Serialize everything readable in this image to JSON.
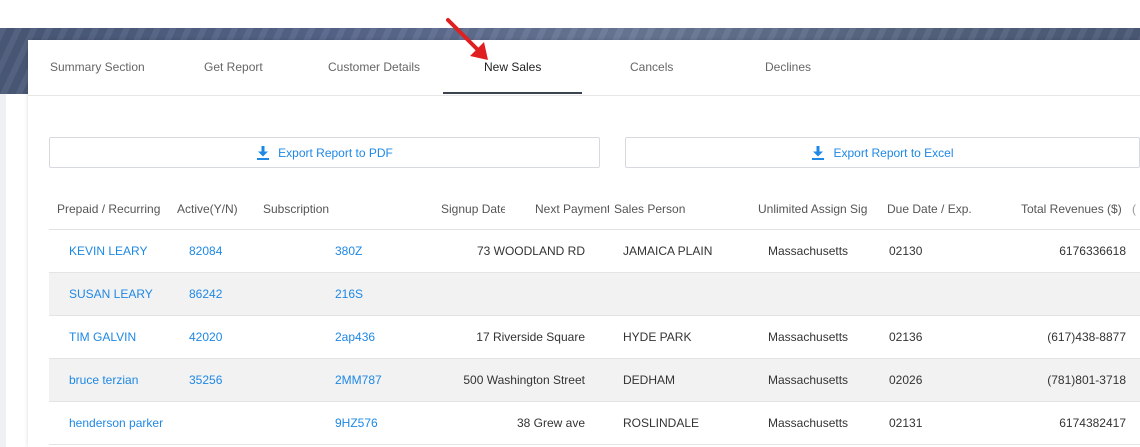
{
  "tabs": [
    {
      "label": "Summary Section"
    },
    {
      "label": "Get Report"
    },
    {
      "label": "Customer Details"
    },
    {
      "label": "New Sales",
      "active": true
    },
    {
      "label": "Cancels"
    },
    {
      "label": "Declines"
    }
  ],
  "export": {
    "pdf_label": "Export Report to PDF",
    "excel_label": "Export Report to Excel"
  },
  "table": {
    "headers": [
      "Prepaid / Recurring",
      "Active(Y/N)",
      "Subscription",
      "Signup Date",
      "Next Payment Da",
      "Sales Person",
      "Unlimited Assign Sign",
      "Due Date / Exp.",
      "Total Revenues ($)",
      "("
    ],
    "rows": [
      {
        "name": "KEVIN LEARY",
        "active": "82084",
        "subscription": "380Z",
        "address": "73 WOODLAND RD",
        "city": "JAMAICA PLAIN",
        "state": "Massachusetts",
        "zip": "02130",
        "phone": "6176336618"
      },
      {
        "name": "SUSAN LEARY",
        "active": "86242",
        "subscription": "216S",
        "address": "",
        "city": "",
        "state": "",
        "zip": "",
        "phone": ""
      },
      {
        "name": "TIM GALVIN",
        "active": "42020",
        "subscription": "2ap436",
        "address": "17 Riverside Square",
        "city": "HYDE PARK",
        "state": "Massachusetts",
        "zip": "02136",
        "phone": "(617)438-8877"
      },
      {
        "name": "bruce terzian",
        "active": "35256",
        "subscription": "2MM787",
        "address": "500 Washington Street",
        "city": "DEDHAM",
        "state": "Massachusetts",
        "zip": "02026",
        "phone": "(781)801-3718"
      },
      {
        "name": "henderson parker",
        "active": "",
        "subscription": "9HZ576",
        "address": "38 Grew ave",
        "city": "ROSLINDALE",
        "state": "Massachusetts",
        "zip": "02131",
        "phone": "6174382417"
      }
    ]
  },
  "colors": {
    "accent": "#1e88e5",
    "annotation_arrow": "#e02020",
    "header_band": "#56658a"
  },
  "icons": {
    "download": "download-icon",
    "annotation": "red-arrow-icon"
  }
}
